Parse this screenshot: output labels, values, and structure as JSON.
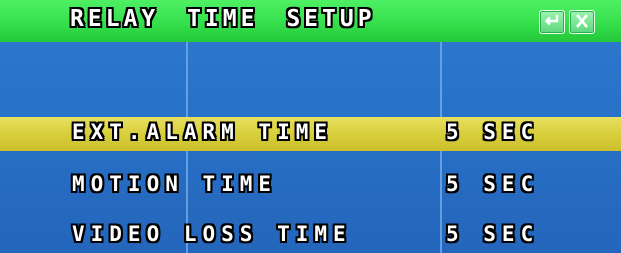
{
  "menu": {
    "title": "RELAY TIME SETUP",
    "buttons": [
      {
        "name": "enter",
        "icon": "enter-return-icon"
      },
      {
        "name": "exit",
        "icon": "exit-x-icon"
      }
    ],
    "rows": [
      {
        "label": "EXT.ALARM TIME",
        "value": "5 SEC",
        "selected": true
      },
      {
        "label": "MOTION TIME",
        "value": "5 SEC",
        "selected": false
      },
      {
        "label": "VIDEO LOSS TIME",
        "value": "5 SEC",
        "selected": false
      }
    ]
  },
  "colors": {
    "titlebar": "#33de4a",
    "background": "#2872c9",
    "selected_row": "#d8cf3c",
    "text": "#ffffff",
    "text_outline": "#000000"
  }
}
